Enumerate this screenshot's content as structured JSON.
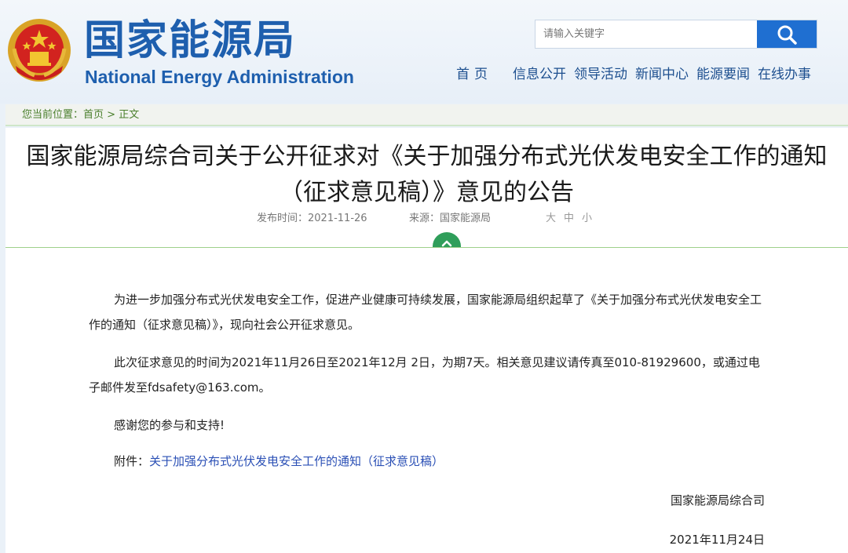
{
  "header": {
    "title_cn": "国家能源局",
    "title_en": "National Energy Administration",
    "search_placeholder": "请输入关键字",
    "nav": [
      "首页",
      "信息公开",
      "领导活动",
      "新闻中心",
      "能源要闻",
      "在线办事"
    ]
  },
  "breadcrumb": {
    "prefix": "您当前位置：",
    "home": "首页",
    "sep": " > ",
    "current": "正文"
  },
  "article": {
    "title": "国家能源局综合司关于公开征求对《关于加强分布式光伏发电安全工作的通知（征求意见稿）》意见的公告",
    "publish_label": "发布时间：",
    "publish_date": "2021-11-26",
    "source_label": "来源：",
    "source": "国家能源局",
    "font_sizes": [
      "大",
      "中",
      "小"
    ],
    "paragraphs": [
      "为进一步加强分布式光伏发电安全工作，促进产业健康可持续发展，国家能源局组织起草了《关于加强分布式光伏发电安全工作的通知（征求意见稿）》，现向社会公开征求意见。",
      "此次征求意见的时间为2021年11月26日至2021年12月 2日，为期7天。相关意见建议请传真至010-81929600，或通过电子邮件发至fdsafety@163.com。",
      "感谢您的参与和支持!"
    ],
    "attachment_label": "附件：",
    "attachment_link": "关于加强分布式光伏发电安全工作的通知（征求意见稿）",
    "signature": "国家能源局综合司",
    "date": "2021年11月24日"
  },
  "colors": {
    "brand_blue": "#1e5fae",
    "search_blue": "#1f6fd1",
    "breadcrumb_green": "#4a7f2c",
    "toggle_green": "#2f9e5a",
    "link_blue": "#2a4fb5"
  }
}
